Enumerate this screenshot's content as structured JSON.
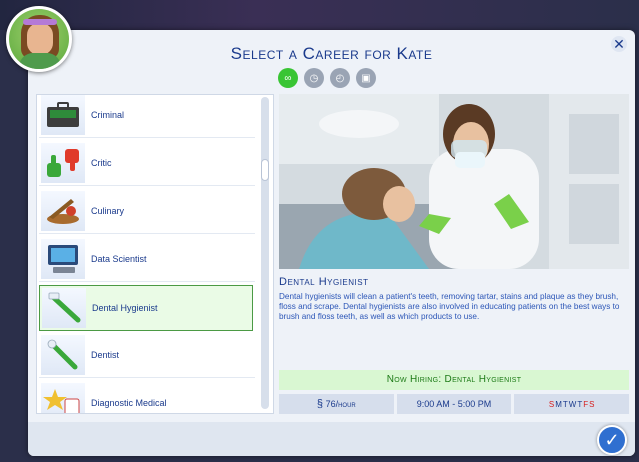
{
  "dialog": {
    "title": "Select a Career for Kate",
    "close_icon": "close-icon",
    "confirm_icon": "checkmark-icon"
  },
  "filters": [
    {
      "name": "all-careers",
      "icon": "infinity-icon",
      "active": true
    },
    {
      "name": "full-time",
      "icon": "briefcase-clock-icon",
      "active": false
    },
    {
      "name": "part-time",
      "icon": "clock-icon",
      "active": false
    },
    {
      "name": "freelance",
      "icon": "folder-icon",
      "active": false
    }
  ],
  "careers": [
    {
      "label": "Criminal",
      "icon": "cash-briefcase-icon"
    },
    {
      "label": "Critic",
      "icon": "thumbs-up-down-icon"
    },
    {
      "label": "Culinary",
      "icon": "food-platter-icon"
    },
    {
      "label": "Data Scientist",
      "icon": "computer-icon"
    },
    {
      "label": "Dental Hygienist",
      "icon": "toothbrush-icon",
      "selected": true
    },
    {
      "label": "Dentist",
      "icon": "dental-tool-icon"
    },
    {
      "label": "Diagnostic Medical",
      "icon": "medical-star-icon"
    }
  ],
  "detail": {
    "career_name": "Dental Hygienist",
    "description": "Dental hygienists will clean a patient's teeth, removing tartar, stains and plaque as they brush, floss and scrape. Dental hygienists are also involved in educating patients on the best ways to brush and floss teeth, as well as which products to use.",
    "hiring": "Now Hiring: Dental Hygienist",
    "pay": "76/hour",
    "pay_symbol": "§",
    "hours": "9:00 AM - 5:00 PM",
    "days": [
      {
        "d": "S",
        "work": false
      },
      {
        "d": "M",
        "work": true
      },
      {
        "d": "T",
        "work": true
      },
      {
        "d": "W",
        "work": true
      },
      {
        "d": "T",
        "work": true
      },
      {
        "d": "F",
        "work": false
      },
      {
        "d": "S",
        "work": false
      }
    ]
  },
  "colors": {
    "accent": "#1a3a8c",
    "hiring_bg": "#d9f7d2",
    "day_off": "#d62020"
  }
}
